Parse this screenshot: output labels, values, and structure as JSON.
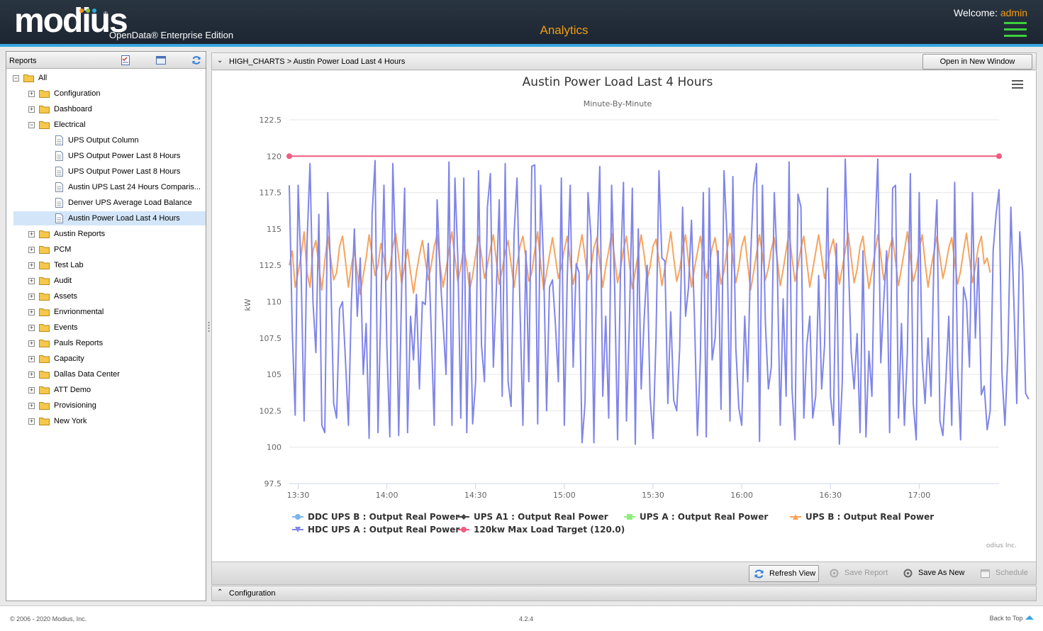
{
  "header": {
    "logo_text": "modius",
    "logo_dot_colors": [
      "#f7941d",
      "#8dc63f",
      "#27aae1",
      "#f7941d",
      "#8dc63f",
      "#27aae1"
    ],
    "edition": "OpenData® Enterprise Edition",
    "app_title": "Analytics",
    "welcome_label": "Welcome:",
    "username": "admin",
    "menu_icon": "hamburger-menu-icon"
  },
  "reports_panel": {
    "title": "Reports",
    "toolbar_icons": [
      "checklist-icon",
      "window-icon",
      "refresh-icon"
    ],
    "tree": [
      {
        "label": "All",
        "level": 0,
        "type": "folder",
        "expanded": true
      },
      {
        "label": "Configuration",
        "level": 1,
        "type": "folder",
        "expanded": false
      },
      {
        "label": "Dashboard",
        "level": 1,
        "type": "folder",
        "expanded": false
      },
      {
        "label": "Electrical",
        "level": 1,
        "type": "folder",
        "expanded": true
      },
      {
        "label": "UPS Output Column",
        "level": 2,
        "type": "report"
      },
      {
        "label": "UPS Output Power Last 8 Hours",
        "level": 2,
        "type": "report"
      },
      {
        "label": "UPS Output Power Last 8 Hours",
        "level": 2,
        "type": "report"
      },
      {
        "label": "Austin UPS Last 24 Hours Comparis...",
        "level": 2,
        "type": "report"
      },
      {
        "label": "Denver UPS Average Load Balance",
        "level": 2,
        "type": "report"
      },
      {
        "label": "Austin Power Load Last 4 Hours",
        "level": 2,
        "type": "report",
        "selected": true
      },
      {
        "label": "Austin Reports",
        "level": 1,
        "type": "folder",
        "expanded": false
      },
      {
        "label": "PCM",
        "level": 1,
        "type": "folder",
        "expanded": false
      },
      {
        "label": "Test Lab",
        "level": 1,
        "type": "folder",
        "expanded": false
      },
      {
        "label": "Audit",
        "level": 1,
        "type": "folder",
        "expanded": false
      },
      {
        "label": "Assets",
        "level": 1,
        "type": "folder",
        "expanded": false
      },
      {
        "label": "Envrionmental",
        "level": 1,
        "type": "folder",
        "expanded": false
      },
      {
        "label": "Events",
        "level": 1,
        "type": "folder",
        "expanded": false
      },
      {
        "label": "Pauls Reports",
        "level": 1,
        "type": "folder",
        "expanded": false
      },
      {
        "label": "Capacity",
        "level": 1,
        "type": "folder",
        "expanded": false
      },
      {
        "label": "Dallas Data Center",
        "level": 1,
        "type": "folder",
        "expanded": false
      },
      {
        "label": "ATT Demo",
        "level": 1,
        "type": "folder",
        "expanded": false
      },
      {
        "label": "Provisioning",
        "level": 1,
        "type": "folder",
        "expanded": false
      },
      {
        "label": "New York",
        "level": 1,
        "type": "folder",
        "expanded": false
      }
    ]
  },
  "report_view": {
    "breadcrumb": "HIGH_CHARTS > Austin Power Load Last 4 Hours",
    "open_new_window": "Open in New Window",
    "credits": "odius Inc.",
    "actions": {
      "refresh": "Refresh View",
      "save": "Save Report",
      "save_as": "Save As New",
      "schedule": "Schedule"
    },
    "configuration_label": "Configuration"
  },
  "chart_data": {
    "type": "line",
    "title": "Austin Power Load Last 4 Hours",
    "subtitle": "Minute-By-Minute",
    "xlabel": "",
    "ylabel": "kW",
    "ylim": [
      97.5,
      122.5
    ],
    "yticks": [
      97.5,
      100,
      102.5,
      105,
      107.5,
      110,
      112.5,
      115,
      117.5,
      120,
      122.5
    ],
    "x_tick_labels": [
      "13:30",
      "14:00",
      "14:30",
      "15:00",
      "15:30",
      "16:00",
      "16:30",
      "17:00"
    ],
    "x_range": [
      "13:27",
      "17:27"
    ],
    "grid": true,
    "legend_position": "bottom",
    "legend": [
      {
        "name": "DDC UPS B : Output Real Power",
        "color": "#7cb5ec",
        "marker": "circle"
      },
      {
        "name": "UPS A1 : Output Real Power",
        "color": "#434348",
        "marker": "diamond"
      },
      {
        "name": "UPS A : Output Real Power",
        "color": "#90ed7d",
        "marker": "square"
      },
      {
        "name": "UPS B : Output Real Power",
        "color": "#f7a35c",
        "marker": "triangle"
      },
      {
        "name": "HDC UPS A : Output Real Power",
        "color": "#8085e9",
        "marker": "triangle-down"
      },
      {
        "name": "120kw Max Load Target (120.0)",
        "color": "#f15c80",
        "marker": "circle"
      }
    ],
    "series": [
      {
        "name": "120kw Max Load Target (120.0)",
        "color": "#f15c80",
        "x": [
          "13:27",
          "17:27"
        ],
        "values": [
          120,
          120
        ]
      },
      {
        "name": "UPS B : Output Real Power",
        "color": "#f7a35c",
        "x_start": "13:27",
        "x_step_minutes": 1,
        "values": [
          112.5,
          113.5,
          111,
          112,
          113.2,
          114.8,
          112,
          111,
          113.5,
          114.2,
          112.5,
          110.8,
          112.8,
          114.5,
          113,
          111.5,
          112,
          113.8,
          114.5,
          112.8,
          111,
          112.5,
          113.5,
          112,
          110.5,
          111.8,
          113,
          114.6,
          113.2,
          111.8,
          112.5,
          114,
          113,
          111.5,
          112.2,
          113.8,
          114.7,
          113,
          111.2,
          112.5,
          113.6,
          112,
          110.6,
          112,
          113.2,
          114.2,
          112.8,
          111.5,
          112.5,
          113.8,
          114.6,
          112.5,
          111,
          112.2,
          113.5,
          114.8,
          113,
          111.4,
          112.4,
          113.8,
          112.5,
          110.8,
          111.8,
          113.2,
          114.5,
          113.2,
          111.6,
          112.5,
          113.6,
          114.6,
          112.8,
          111.2,
          112.2,
          113.4,
          114.2,
          112.6,
          111,
          112.5,
          113.8,
          114.5,
          113,
          111.4,
          112,
          113.5,
          114.8,
          112.6,
          110.8,
          112,
          113.2,
          114.4,
          113,
          111.6,
          112.4,
          113.6,
          114.5,
          112.8,
          111.2,
          112.2,
          113.5,
          114.6,
          113.1,
          111.5,
          112.3,
          113.7,
          114.4,
          112.7,
          111,
          112.4,
          113.5,
          114.7,
          113,
          111.3,
          112.2,
          113.6,
          114.5,
          112.6,
          110.9,
          112.1,
          113.3,
          114.6,
          113.2,
          111.5,
          112.4,
          113.8,
          114.3,
          112.8,
          111.1,
          112.3,
          113.5,
          114.8,
          113,
          111.4,
          112.2,
          113.6,
          114.6,
          112.7,
          111,
          112.3,
          113.4,
          114.5,
          113.1,
          111.6,
          112.5,
          113.7,
          114.4,
          112.8,
          111.2,
          112.1,
          113.5,
          114.7,
          113,
          111.3,
          112.4,
          113.8,
          114.5,
          112.6,
          110.8,
          112,
          113.3,
          114.6,
          113.2,
          111.5,
          112.3,
          113.6,
          114.4,
          112.9,
          111.1,
          112.2,
          113.5,
          114.8,
          113,
          111.4,
          112.4,
          113.7,
          114.5,
          112.7,
          111,
          112.2,
          113.4,
          114.6,
          113.1,
          111.6,
          112.5,
          113.6,
          114.3,
          112.8,
          111.2,
          112.3,
          113.5,
          114.7,
          113,
          111.3,
          112.2,
          113.8,
          114.5,
          112.6,
          110.9,
          112.1,
          113.3,
          114.6,
          113.2,
          111.5,
          112.4,
          113.7,
          114.4,
          112.8,
          111.1,
          112.3,
          113.5,
          114.8,
          113,
          111.4,
          112.2,
          113.6,
          114.6,
          112.7,
          111,
          112.3,
          113.4,
          114.5,
          113.1,
          111.6,
          112.5,
          113.7,
          114.4,
          112.8,
          111.2,
          112.1,
          113.5,
          114.7,
          113,
          111.3,
          112.4,
          113.8,
          114.5,
          112.6,
          113,
          112
        ]
      },
      {
        "name": "HDC UPS A : Output Real Power",
        "color": "#8085e9",
        "x_start": "13:27",
        "x_step_minutes": 1,
        "values": [
          118,
          108,
          102.2,
          118,
          112,
          101.8,
          114,
          119.5,
          110,
          106.5,
          116,
          101.5,
          101,
          117.5,
          112,
          103,
          102,
          109.5,
          110,
          106,
          101.5,
          110,
          115,
          109,
          113,
          105,
          108.5,
          100.6,
          116,
          119.7,
          101,
          110,
          118,
          107,
          100.7,
          119.5,
          113,
          100.8,
          111,
          117.8,
          101,
          109,
          106,
          110.5,
          104,
          110,
          109.8,
          114,
          108,
          101.5,
          117,
          112,
          108.5,
          105,
          119.6,
          101.5,
          118.5,
          113,
          102,
          118.5,
          101,
          112,
          101.6,
          104.5,
          119,
          107,
          104.5,
          116.5,
          118.8,
          105.5,
          110.8,
          117,
          103.5,
          119.5,
          104.5,
          102.8,
          114.6,
          118.5,
          109.7,
          101.5,
          113.5,
          104.5,
          119.3,
          119.4,
          101.6,
          118,
          112.5,
          102.5,
          111,
          111.5,
          108.4,
          104.5,
          118.5,
          101.5,
          111.8,
          118,
          105.5,
          112.6,
          112,
          100.3,
          103,
          117.5,
          114.5,
          100.3,
          113,
          119.3,
          103.5,
          109,
          102,
          118,
          111.2,
          100.5,
          112,
          118.2,
          101.8,
          108.5,
          117.8,
          100.2,
          115,
          104,
          108.8,
          112.5,
          103.5,
          100.6,
          107.5,
          119,
          113,
          112.8,
          103,
          109.3,
          103.2,
          102.5,
          106.8,
          116.5,
          109,
          111,
          115.6,
          109,
          100.8,
          106,
          117.5,
          100.7,
          117.8,
          106,
          107.5,
          113.5,
          102.6,
          119,
          114.5,
          101.8,
          118.6,
          106.8,
          102.7,
          101.5,
          109,
          104.5,
          113,
          118,
          119.5,
          100.4,
          118,
          108.5,
          104,
          105.5,
          117.5,
          112.5,
          101.5,
          110.2,
          103.5,
          119.6,
          104,
          100.5,
          117.4,
          116.5,
          102,
          107,
          109,
          102,
          103.5,
          111.8,
          104,
          107,
          117.8,
          103.5,
          101.5,
          114,
          100.2,
          104.5,
          119.8,
          113,
          106.5,
          104,
          107.8,
          101,
          113.5,
          100.7,
          106.6,
          103.5,
          114.5,
          119.8,
          105.8,
          110,
          113.5,
          101,
          117.8,
          118,
          102,
          108.5,
          101.5,
          106.5,
          118.8,
          103,
          100.5,
          117.5,
          106,
          103,
          107.5,
          103.5,
          113,
          117,
          101.8,
          100.8,
          104.5,
          109,
          101.5,
          118.2,
          105.5,
          100.5,
          111,
          110,
          105.5,
          117.5,
          107.5,
          113,
          103.6,
          104.2,
          101.2,
          102.5,
          113.5,
          116,
          117.7,
          105,
          101.5,
          106.5,
          116.5,
          110,
          103,
          114.8,
          112,
          103.7,
          103.3
        ]
      }
    ]
  }
}
